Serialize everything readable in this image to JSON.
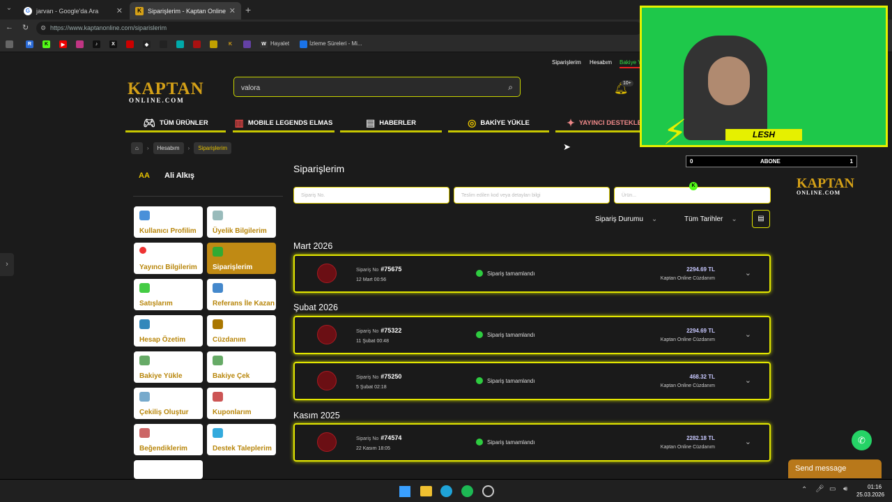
{
  "browser": {
    "tabs": [
      {
        "title": "jarvan - Google'da Ara",
        "icon": "google-icon"
      },
      {
        "title": "Siparişlerim - Kaptan Online",
        "icon": "kaptan-icon"
      }
    ],
    "url": "https://www.kaptanonline.com/siparislerim",
    "bookmarks": [
      "Hayalet",
      "İzleme Süreleri - Mi..."
    ]
  },
  "header": {
    "top_links": [
      "Siparişlerim",
      "Hesabım",
      "Bakiye Y"
    ],
    "logo_top": "KAPTAN",
    "logo_bottom": "ONLINE.COM",
    "search_value": "valora",
    "notif_count": "10+"
  },
  "nav": [
    {
      "label": "TÜM ÜRÜNLER",
      "icon": "gamepad-icon"
    },
    {
      "label": "MOBILE LEGENDS ELMAS",
      "icon": "shop-icon"
    },
    {
      "label": "HABERLER",
      "icon": "news-icon"
    },
    {
      "label": "BAKİYE YÜKLE",
      "icon": "coins-icon"
    },
    {
      "label": "YAYINCI DESTEKLE",
      "icon": "streamer-icon"
    }
  ],
  "breadcrumb": {
    "home": "home-icon",
    "items": [
      "Hesabım",
      "Siparişlerim"
    ]
  },
  "user": {
    "initials": "AA",
    "name": "Ali Alkış"
  },
  "sidebar_cards": [
    "Kullanıcı Profilim",
    "Üyelik Bilgilerim",
    "Yayıncı Bilgilerim",
    "Siparişlerim",
    "Satışlarım",
    "Referans İle Kazan",
    "Hesap Özetim",
    "Cüzdanım",
    "Bakiye Yükle",
    "Bakiye Çek",
    "Çekiliş Oluştur",
    "Kuponlarım",
    "Beğendiklerim",
    "Destek Taleplerim"
  ],
  "main": {
    "title": "Siparişlerim",
    "filters": {
      "order_no_placeholder": "Sipariş No.",
      "code_placeholder": "Teslim edilen kod veya detayları bilgi",
      "product_placeholder": "Ürün..."
    },
    "status_dropdown": "Sipariş Durumu",
    "date_dropdown": "Tüm Tarihler",
    "order_label": "Sipariş No",
    "groups": [
      {
        "month": "Mart 2026",
        "orders": [
          {
            "no": "#75675",
            "date": "12 Mart 00:56",
            "status": "Sipariş tamamlandı",
            "amount": "2294.69 TL",
            "source": "Kaptan Online Cüzdanım"
          }
        ]
      },
      {
        "month": "Şubat 2026",
        "orders": [
          {
            "no": "#75322",
            "date": "11 Şubat 00:48",
            "status": "Sipariş tamamlandı",
            "amount": "2294.69 TL",
            "source": "Kaptan Online Cüzdanım"
          },
          {
            "no": "#75250",
            "date": "5 Şubat 02:18",
            "status": "Sipariş tamamlandı",
            "amount": "468.32 TL",
            "source": "Kaptan Online Cüzdanım"
          }
        ]
      },
      {
        "month": "Kasım 2025",
        "orders": [
          {
            "no": "#74574",
            "date": "22 Kasım 18:05",
            "status": "Sipariş tamamlandı",
            "amount": "2282.18 TL",
            "source": "Kaptan Online Cüzdanım"
          }
        ]
      }
    ]
  },
  "overlay": {
    "streamer": "LESH",
    "abone_left": "0",
    "abone_label": "ABONE",
    "abone_right": "1"
  },
  "chat": {
    "send_message": "Send message"
  },
  "taskbar": {
    "time": "01:16",
    "date": "25.03.2026"
  },
  "colors": {
    "accent_yellow": "#e3e600",
    "gold": "#d4a017",
    "active_card": "#c08a14",
    "success": "#2ecc40"
  }
}
